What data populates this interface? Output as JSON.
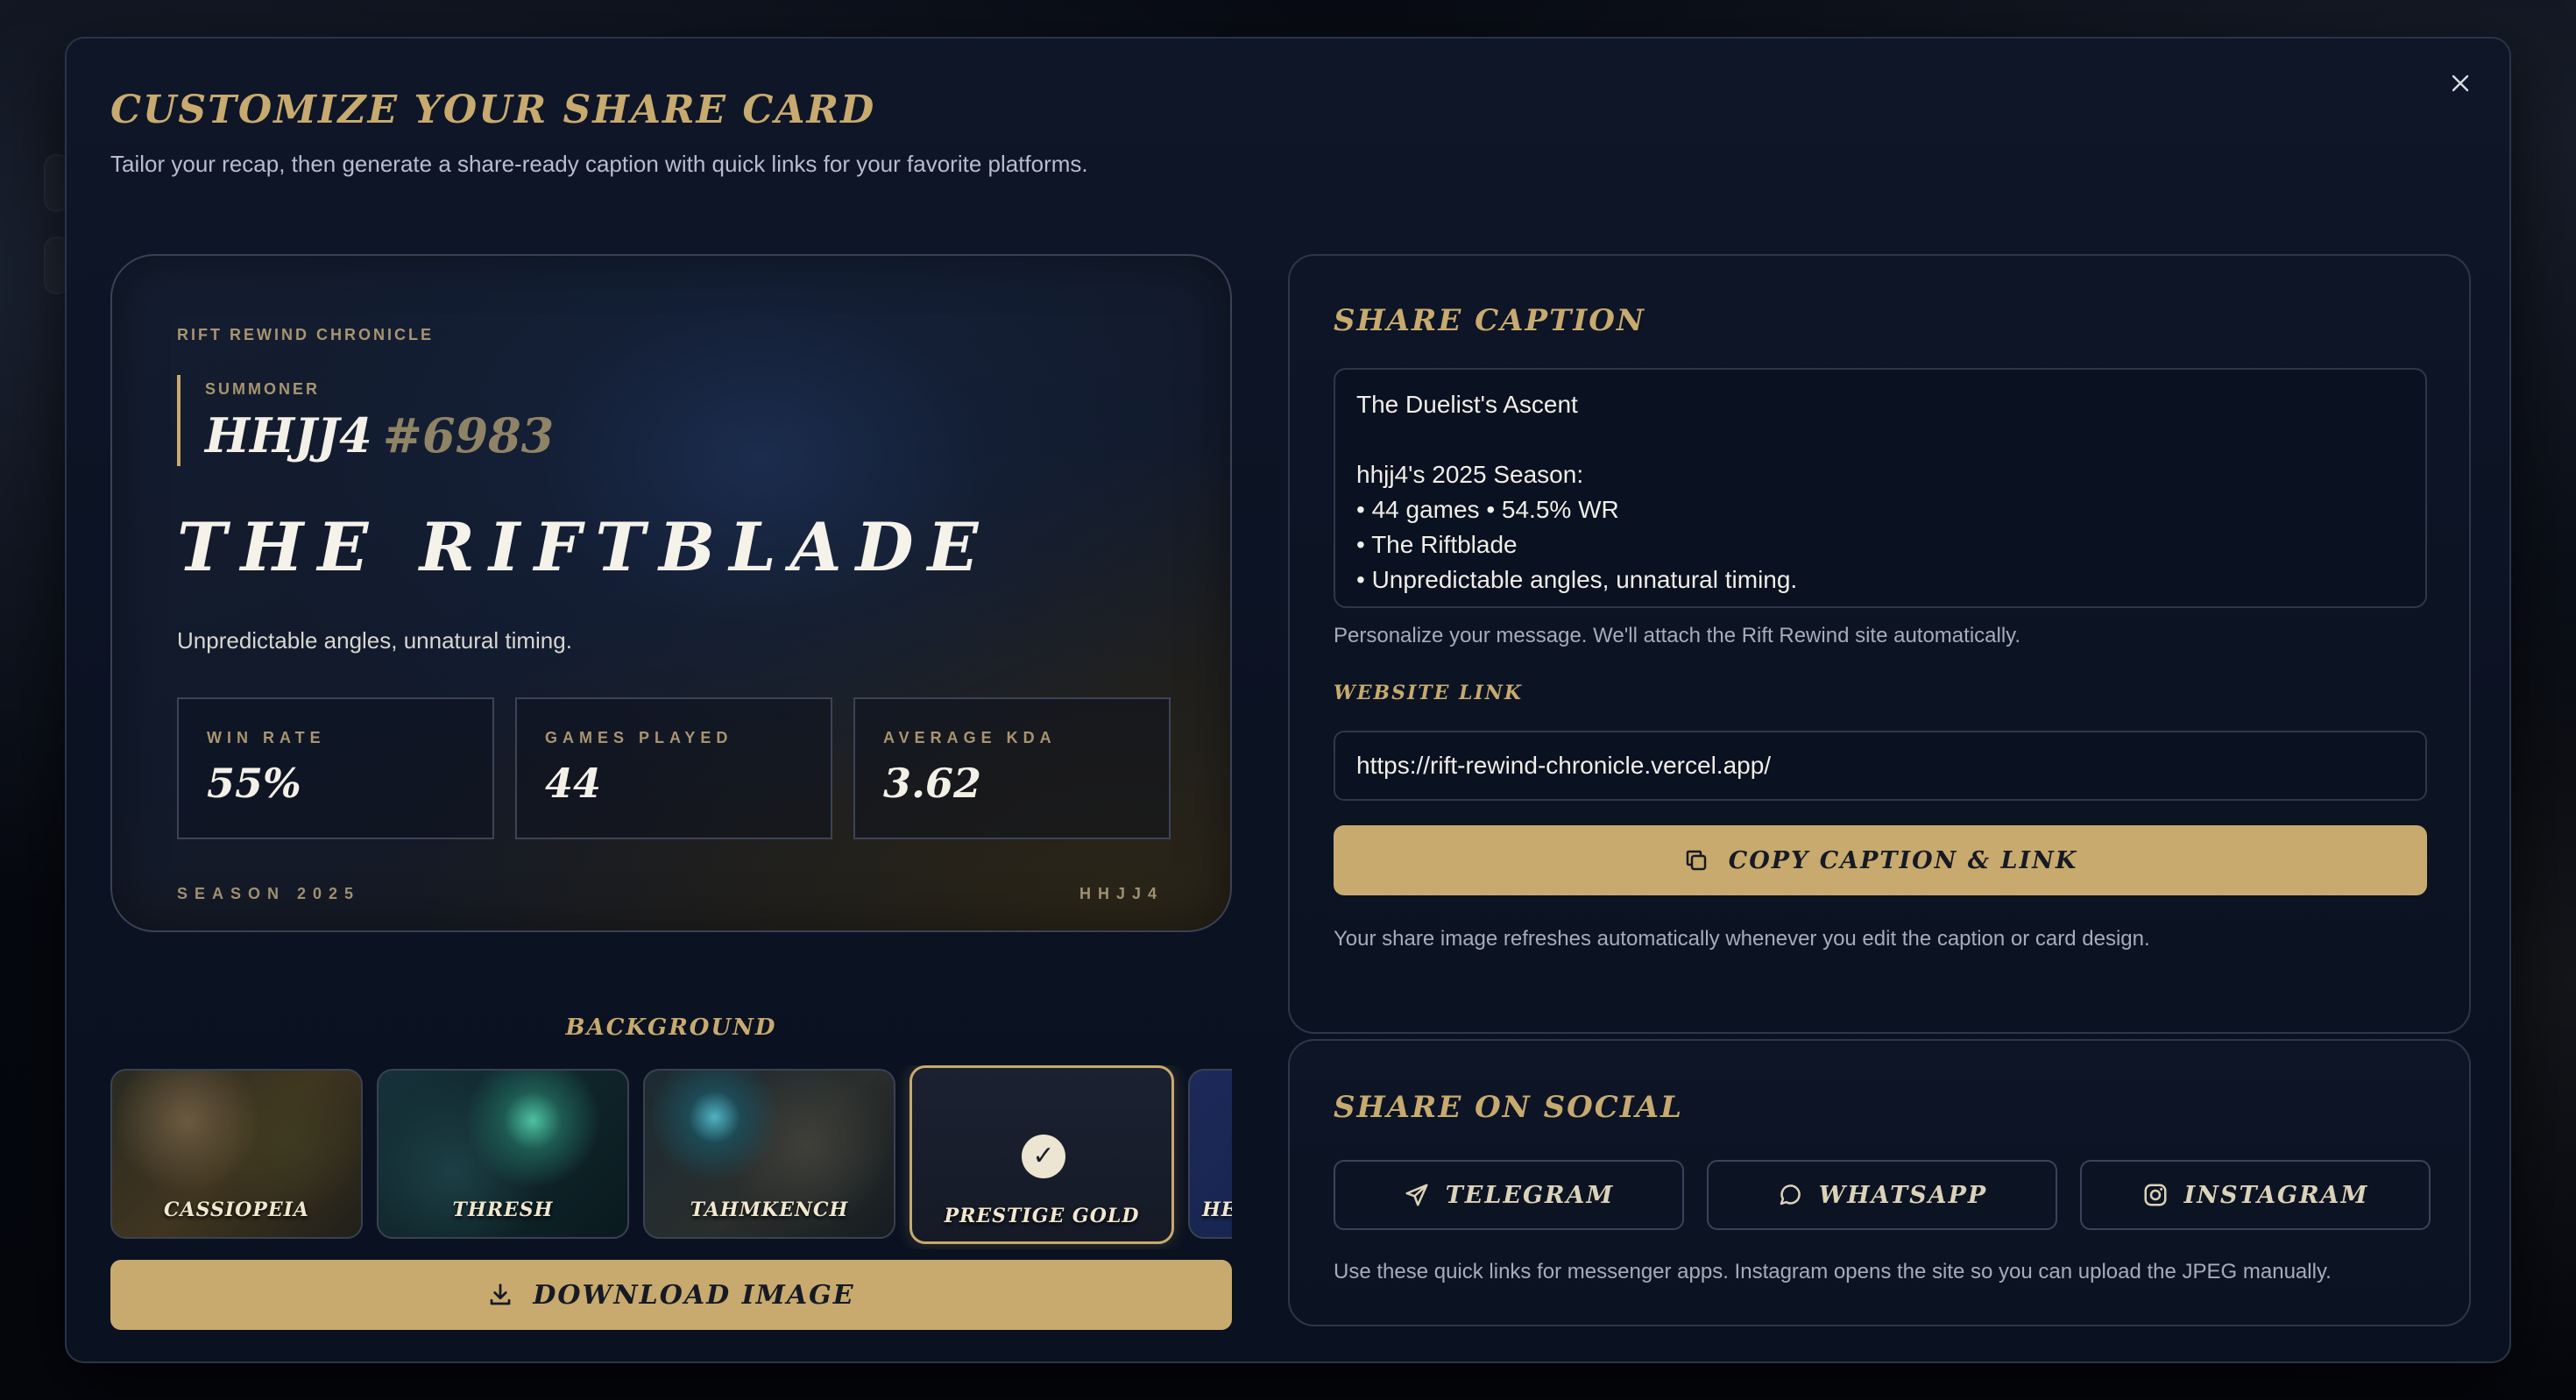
{
  "modal": {
    "title": "CUSTOMIZE YOUR SHARE CARD",
    "subtitle": "Tailor your recap, then generate a share-ready caption with quick links for your favorite platforms.",
    "close_icon": "close-icon"
  },
  "card": {
    "eyebrow": "RIFT REWIND CHRONICLE",
    "summoner_label": "SUMMONER",
    "summoner_name": "HHJJ4",
    "summoner_tag": "#6983",
    "title": "THE RIFTBLADE",
    "tagline": "Unpredictable angles, unnatural timing.",
    "stats": [
      {
        "label": "WIN RATE",
        "value": "55%"
      },
      {
        "label": "GAMES PLAYED",
        "value": "44"
      },
      {
        "label": "AVERAGE KDA",
        "value": "3.62"
      }
    ],
    "footer_left": "SEASON 2025",
    "footer_right": "HHJJ4"
  },
  "background": {
    "label": "BACKGROUND",
    "options": [
      "CASSIOPEIA",
      "THRESH",
      "TAHMKENCH",
      "PRESTIGE GOLD",
      "HEX"
    ],
    "selected": "PRESTIGE GOLD"
  },
  "download_label": "DOWNLOAD IMAGE",
  "share_caption": {
    "title": "SHARE CAPTION",
    "caption": "The Duelist's Ascent\n\nhhjj4's 2025 Season:\n• 44 games • 54.5% WR\n• The Riftblade\n• Unpredictable angles, unnatural timing.",
    "hint": "Personalize your message. We'll attach the Rift Rewind site automatically.",
    "website_label": "WEBSITE LINK",
    "website_value": "https://rift-rewind-chronicle.vercel.app/",
    "copy_label": "COPY CAPTION & LINK",
    "refresh_note": "Your share image refreshes automatically whenever you edit the caption or card design."
  },
  "share_social": {
    "title": "SHARE ON SOCIAL",
    "buttons": [
      {
        "label": "TELEGRAM",
        "icon": "send-icon"
      },
      {
        "label": "WHATSAPP",
        "icon": "chat-bubble-icon"
      },
      {
        "label": "INSTAGRAM",
        "icon": "instagram-icon"
      }
    ],
    "note": "Use these quick links for messenger apps. Instagram opens the site so you can upload the JPEG manually."
  },
  "colors": {
    "accent_gold": "#c8aa6e",
    "modal_bg": "#0e1628",
    "text_primary": "#f0eee8"
  }
}
